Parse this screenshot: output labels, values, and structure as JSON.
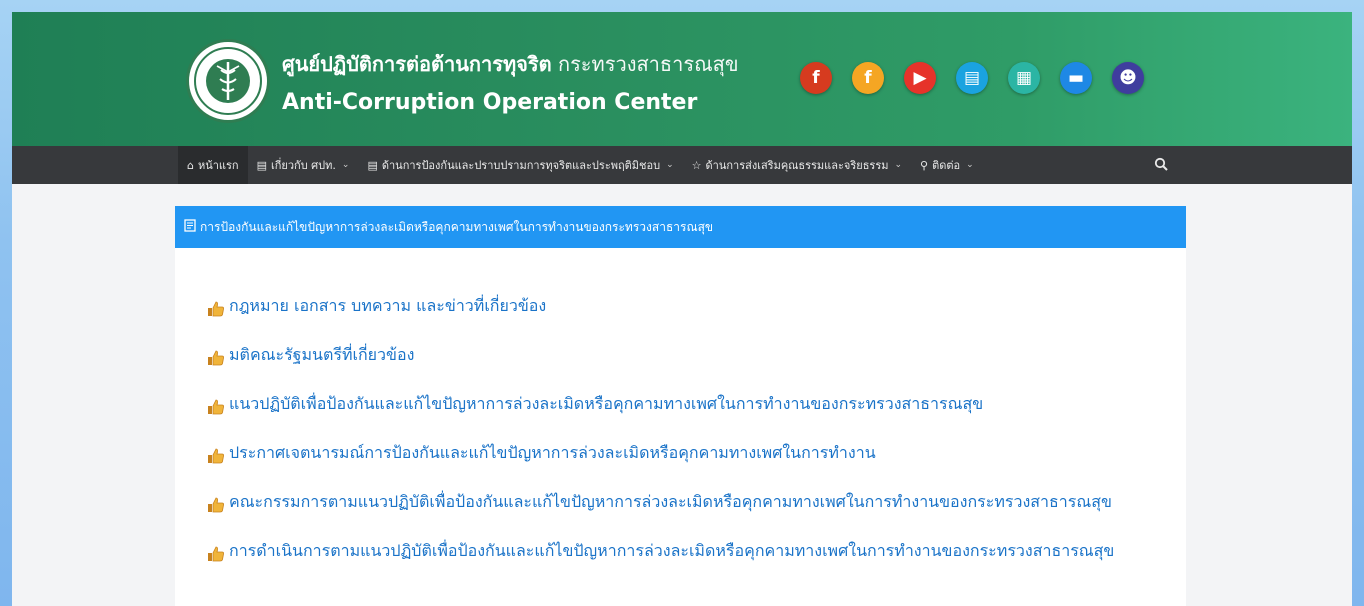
{
  "header": {
    "title_th_bold": "ศูนย์ปฏิบัติการต่อต้านการทุจริต",
    "title_th_org": "กระทรวงสาธารณสุข",
    "title_en": "Anti-Corruption Operation Center",
    "seal_icon": "ministry-of-public-health-seal-icon",
    "social": [
      {
        "name": "facebook-icon",
        "glyph": "f",
        "color": "#d63b1f"
      },
      {
        "name": "facebook-alt-icon",
        "glyph": "f",
        "color": "#f5a623"
      },
      {
        "name": "youtube-icon",
        "glyph": "▶",
        "color": "#e6332a"
      },
      {
        "name": "clipboard-icon",
        "glyph": "▤",
        "color": "#1aa3e0"
      },
      {
        "name": "gallery-icon",
        "glyph": "▦",
        "color": "#2bb5a4"
      },
      {
        "name": "folder-icon",
        "glyph": "▬",
        "color": "#1e88e5"
      },
      {
        "name": "users-icon",
        "glyph": "☻",
        "color": "#3f3d9e"
      }
    ]
  },
  "nav": {
    "items": [
      {
        "label": "หน้าแรก",
        "icon": "home-icon",
        "glyph": "⌂",
        "has_caret": false,
        "active": true
      },
      {
        "label": "เกี่ยวกับ ศปท.",
        "icon": "doc-icon",
        "glyph": "▤",
        "has_caret": true,
        "active": false
      },
      {
        "label": "ด้านการป้องกันและปราบปรามการทุจริตและประพฤติมิชอบ",
        "icon": "doc-icon",
        "glyph": "▤",
        "has_caret": true,
        "active": false
      },
      {
        "label": "ด้านการส่งเสริมคุณธรรมและจริยธรรม",
        "icon": "star-icon",
        "glyph": "☆",
        "has_caret": true,
        "active": false
      },
      {
        "label": "ติดต่อ",
        "icon": "map-marker-icon",
        "glyph": "⚲",
        "has_caret": true,
        "active": false
      }
    ],
    "search_icon": "search-icon"
  },
  "content": {
    "title": "การป้องกันและแก้ไขปัญหาการล่วงละเมิดหรือคุกคามทางเพศในการทำงานของกระทรวงสาธารณสุข",
    "links": [
      "กฎหมาย เอกสาร บทความ และข่าวที่เกี่ยวข้อง",
      "มติคณะรัฐมนตรีที่เกี่ยวข้อง",
      "แนวปฏิบัติเพื่อป้องกันและแก้ไขปัญหาการล่วงละเมิดหรือคุกคามทางเพศในการทำงานของกระทรวงสาธารณสุข",
      "ประกาศเจตนารมณ์การป้องกันและแก้ไขปัญหาการล่วงละเมิดหรือคุกคามทางเพศในการทำงาน",
      "คณะกรรมการตามแนวปฏิบัติเพื่อป้องกันและแก้ไขปัญหาการล่วงละเมิดหรือคุกคามทางเพศในการทำงานของกระทรวงสาธารณสุข",
      "การดำเนินการตามแนวปฏิบัติเพื่อป้องกันและแก้ไขปัญหาการล่วงละเมิดหรือคุกคามทางเพศในการทำงานของกระทรวงสาธารณสุข"
    ]
  },
  "colors": {
    "header_green": "#2a8f5f",
    "nav_dark": "#37393c",
    "title_blue": "#2196f3",
    "link_blue": "#1a73c8"
  }
}
